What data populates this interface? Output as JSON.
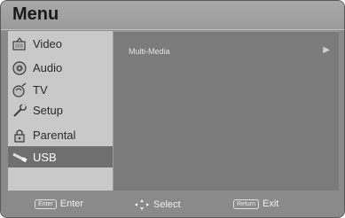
{
  "menu": {
    "title": "Menu"
  },
  "sidebar": {
    "items": [
      {
        "label": "Video",
        "icon": "video-icon"
      },
      {
        "label": "Audio",
        "icon": "audio-icon"
      },
      {
        "label": "TV",
        "icon": "tv-icon"
      },
      {
        "label": "Setup",
        "icon": "setup-icon"
      },
      {
        "label": "Parental",
        "icon": "lock-icon"
      },
      {
        "label": "USB",
        "icon": "usb-icon",
        "selected": true
      }
    ]
  },
  "content": {
    "items": [
      {
        "label": "Multi-Media",
        "arrow": "▶"
      }
    ]
  },
  "footer": {
    "enter_key": "Enter",
    "enter_label": "Enter",
    "select_label": "Select",
    "return_key": "Return",
    "exit_label": "Exit"
  }
}
